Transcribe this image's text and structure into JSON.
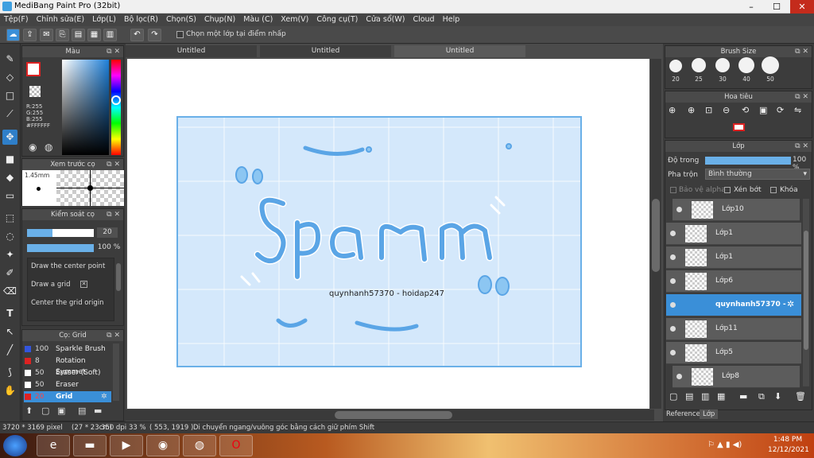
{
  "window": {
    "title": "MediBang Paint Pro (32bit)",
    "min": "–",
    "max": "☐",
    "close": "✕"
  },
  "menu": [
    "Tệp(F)",
    "Chỉnh sửa(E)",
    "Lớp(L)",
    "Bộ lọc(R)",
    "Chọn(S)",
    "Chụp(N)",
    "Màu (C)",
    "Xem(V)",
    "Công cụ(T)",
    "Cửa sổ(W)",
    "Cloud",
    "Help"
  ],
  "toolbar": {
    "checkbox_label": "Chọn một lớp tại điểm nhấp"
  },
  "color_panel": {
    "title": "Màu",
    "r": "R:255",
    "g": "G:255",
    "b": "B:255",
    "hex": "#FFFFFF"
  },
  "brush_preview": {
    "title": "Xem trước cọ",
    "size": "1.45mm"
  },
  "brush_control": {
    "title": "Kiểm soát cọ",
    "size_value": "20",
    "opacity_value": "100 %",
    "options": [
      "Draw the center point",
      "Draw a grid",
      "Center the grid origin"
    ]
  },
  "brush_list": {
    "title": "Cọ: Grid",
    "items": [
      {
        "num": "100",
        "name": "Sparkle Brush",
        "color": "#3355dd"
      },
      {
        "num": "8",
        "name": "Rotation Symmet",
        "color": "#dd2222"
      },
      {
        "num": "50",
        "name": "Eraser (Soft)",
        "color": "#ffffff"
      },
      {
        "num": "50",
        "name": "Eraser",
        "color": "#ffffff"
      },
      {
        "num": "20",
        "name": "Grid",
        "color": "#dd2222",
        "selected": true
      }
    ]
  },
  "tabs": [
    "Untitled",
    "Untitled",
    "Untitled"
  ],
  "artwork": {
    "title": "Spam",
    "credit": "quynhanh57370 - hoidap247"
  },
  "brush_size": {
    "title": "Brush Size",
    "sizes": [
      "20",
      "25",
      "30",
      "40",
      "50"
    ]
  },
  "navigator": {
    "title": "Hoa tiêu"
  },
  "layers": {
    "title": "Lớp",
    "opacity_label": "Độ trong",
    "opacity_value": "100 %",
    "blend_label": "Pha trộn",
    "blend_value": "Bình thường",
    "protect_alpha": "Bảo vệ alpha",
    "clip": "Xén bớt",
    "lock": "Khóa",
    "items": [
      "Lớp10",
      "Lớp1",
      "Lớp1",
      "Lớp6",
      "quynhanh57370 - ",
      "Lớp11",
      "Lớp5",
      "Lớp8"
    ],
    "bottom_tabs": [
      "Reference",
      "Lớp"
    ]
  },
  "status": {
    "size": "3720 * 3169 pixel",
    "dims": "(27 * 23cm)",
    "dpi": "350 dpi",
    "zoom": "33 %",
    "coords": "( 553, 1919 )",
    "hint": "Di chuyển ngang/vuông góc bằng cách giữ phím Shift"
  },
  "taskbar": {
    "time": "1:48 PM",
    "date": "12/12/2021"
  }
}
